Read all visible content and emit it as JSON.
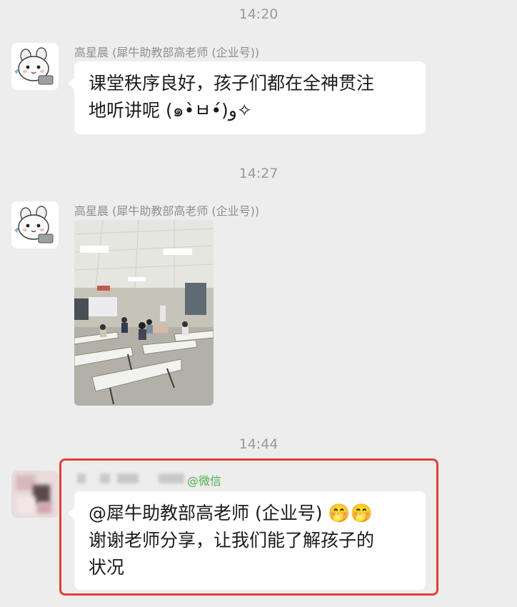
{
  "messages": [
    {
      "time": "14:20",
      "sender": "高星晨 (犀牛助教部高老师 (企业号))",
      "text_lines": [
        "课堂秩序良好，孩子们都在全神贯注",
        "地听讲呢 (๑•̀ㅂ•́)و✧"
      ]
    },
    {
      "time": "14:27",
      "sender": "高星晨 (犀牛助教部高老师 (企业号))",
      "image": "classroom-photo"
    },
    {
      "time": "14:44",
      "sender_suffix": "@微信",
      "text_lines": [
        "@犀牛助教部高老师 (企业号) 🤭🤭",
        "谢谢老师分享，让我们能了解孩子的",
        "状况"
      ]
    }
  ],
  "colors": {
    "background": "#ededed",
    "bubble": "#ffffff",
    "highlight_border": "#e23e36",
    "wechat_green": "#4caf50"
  }
}
